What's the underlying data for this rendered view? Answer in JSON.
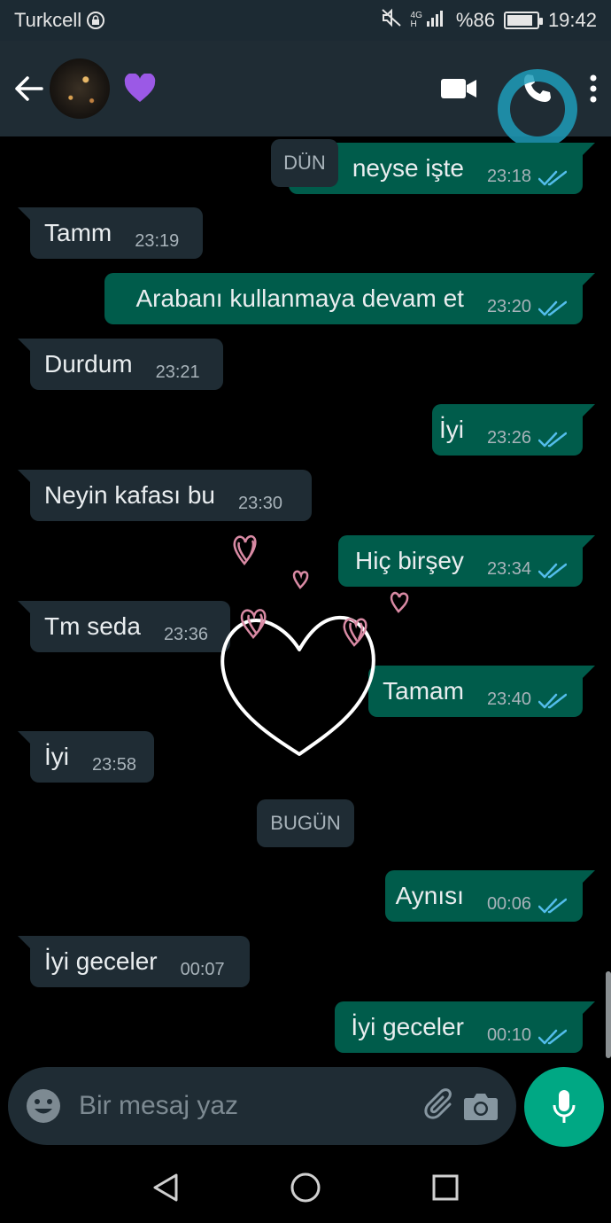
{
  "status_bar": {
    "carrier": "Turkcell",
    "network_tag_top": "4G",
    "network_tag_bottom": "H",
    "battery": "%86",
    "battery_level": 0.86,
    "time": "19:42"
  },
  "header": {
    "contact_name_emoji": "💜",
    "icons": [
      "back-arrow-icon",
      "video-call-icon",
      "voice-call-icon",
      "more-options-icon"
    ]
  },
  "chat": {
    "date_separators": [
      "DÜN",
      "BUGÜN"
    ],
    "messages": [
      {
        "dir": "out",
        "text": "neyse işte",
        "time": "23:18",
        "read": true
      },
      {
        "dir": "in",
        "text": "Tamm",
        "time": "23:19"
      },
      {
        "dir": "out",
        "text": "Arabanı kullanmaya devam et",
        "time": "23:20",
        "read": true
      },
      {
        "dir": "in",
        "text": "Durdum",
        "time": "23:21"
      },
      {
        "dir": "out",
        "text": "İyi",
        "time": "23:26",
        "read": true
      },
      {
        "dir": "in",
        "text": "Neyin kafası bu",
        "time": "23:30"
      },
      {
        "dir": "out",
        "text": "Hiç birşey",
        "time": "23:34",
        "read": true
      },
      {
        "dir": "in",
        "text": "Tm seda",
        "time": "23:36"
      },
      {
        "dir": "out",
        "text": "Tamam",
        "time": "23:40",
        "read": true
      },
      {
        "dir": "in",
        "text": "İyi",
        "time": "23:58"
      },
      {
        "dir": "out",
        "text": "Aynısı",
        "time": "00:06",
        "read": true
      },
      {
        "dir": "in",
        "text": "İyi geceler",
        "time": "00:07"
      },
      {
        "dir": "out",
        "text": "İyi geceler",
        "time": "00:10",
        "read": true
      }
    ]
  },
  "composer": {
    "placeholder": "Bir mesaj yaz"
  },
  "colors": {
    "incoming_bubble": "#1f2c34",
    "outgoing_bubble": "#005c4b",
    "read_ticks": "#53bdeb",
    "accent": "#00a884"
  }
}
